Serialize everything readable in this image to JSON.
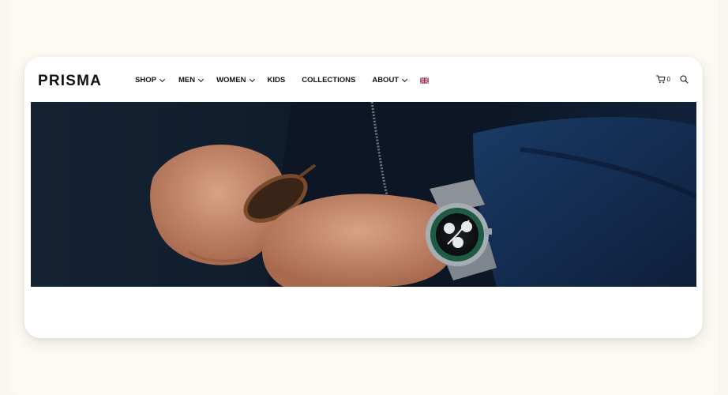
{
  "brand": {
    "logo_text": "PRISMA"
  },
  "nav": {
    "items": [
      {
        "label": "SHOP",
        "dropdown": true
      },
      {
        "label": "MEN",
        "dropdown": true
      },
      {
        "label": "WOMEN",
        "dropdown": true
      },
      {
        "label": "KIDS",
        "dropdown": false
      },
      {
        "label": "COLLECTIONS",
        "dropdown": false
      },
      {
        "label": "ABOUT",
        "dropdown": true
      }
    ],
    "language_icon": "uk-flag-icon"
  },
  "header_actions": {
    "cart_icon": "cart-icon",
    "cart_count": "0",
    "search_icon": "search-icon"
  },
  "hero": {
    "image_subject": "hands adjusting sunglasses, wristwatch with green bezel, dark jacket"
  },
  "colors": {
    "page_background": "#faf6f1",
    "card_background": "#ffffff",
    "text": "#111111",
    "hero_dark": "#0d1a2a",
    "watch_bezel": "#1f5a45"
  }
}
